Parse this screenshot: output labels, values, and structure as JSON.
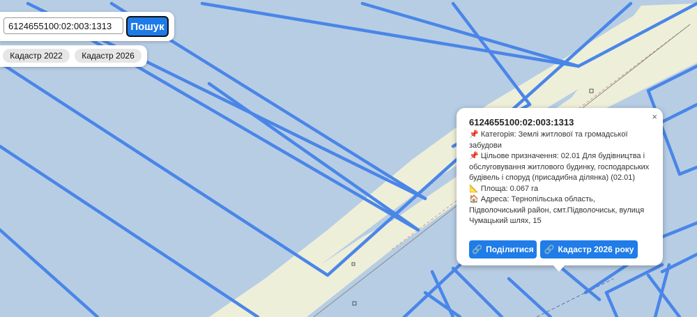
{
  "search": {
    "value": "6124655100:02:003:1313",
    "button_label": "Пошук"
  },
  "layers": [
    {
      "label": "Кадастр 2022"
    },
    {
      "label": "Кадастр 2026"
    }
  ],
  "popup": {
    "close_glyph": "×",
    "title": "6124655100:02:003:1313",
    "category": "📌 Категорія: Землі житлової та громадської забудови",
    "purpose": "📌 Цільове призначення: 02.01 Для будівництва і обслуговування житлового будинку, господарських будівель і споруд (присадибна ділянка) (02.01)",
    "area": "📐 Площа: 0.067 га",
    "address": "🏠 Адреса: Тернопільська область, Підволочиський район, смт.Підволочиськ, вулиця Чумацький шлях, 15",
    "share_label": "Поділитися",
    "cadastre_label": "Кадастр 2026 року",
    "link_icon": "🔗"
  },
  "colors": {
    "parcel_fill": "#b7cde4",
    "parcel_border": "#4a86e8",
    "road_fill": "#eeefd8",
    "accent": "#1f7ce8"
  },
  "icons": {
    "category": "pin-icon",
    "purpose": "pin-icon",
    "area": "ruler-icon",
    "address": "house-icon",
    "share": "link-icon",
    "cadastre": "link-icon"
  }
}
